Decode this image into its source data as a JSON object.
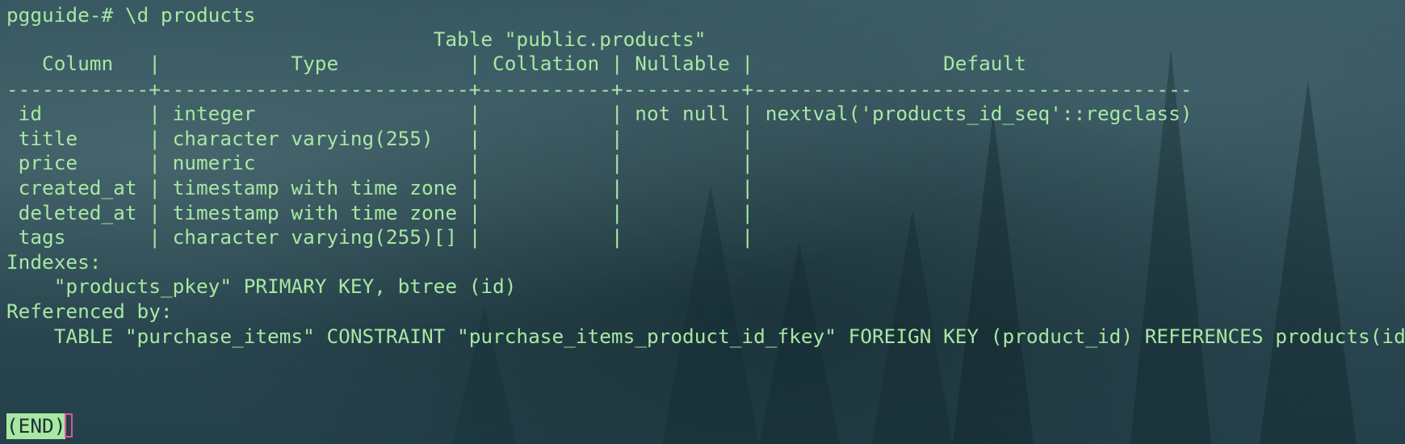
{
  "terminal": {
    "prompt_line": "pgguide-# \\d products",
    "table_title": "                                    Table \"public.products\"",
    "header_row": "   Column   |           Type           | Collation | Nullable |                Default",
    "separator_row": "------------+--------------------------+-----------+----------+-------------------------------------",
    "rows": [
      " id         | integer                  |           | not null | nextval('products_id_seq'::regclass)",
      " title      | character varying(255)   |           |          |",
      " price      | numeric                  |           |          |",
      " created_at | timestamp with time zone |           |          |",
      " deleted_at | timestamp with time zone |           |          |",
      " tags       | character varying(255)[] |           |          |"
    ],
    "indexes_label": "Indexes:",
    "index_line": "    \"products_pkey\" PRIMARY KEY, btree (id)",
    "referenced_label": "Referenced by:",
    "referenced_line": "    TABLE \"purchase_items\" CONSTRAINT \"purchase_items_product_id_fkey\" FOREIGN KEY (product_id) REFERENCES products(id)",
    "end_label": "(END)"
  },
  "colors": {
    "text": "#a7e8a3",
    "cursor": "#e0558f",
    "background": "#2d4b54"
  }
}
